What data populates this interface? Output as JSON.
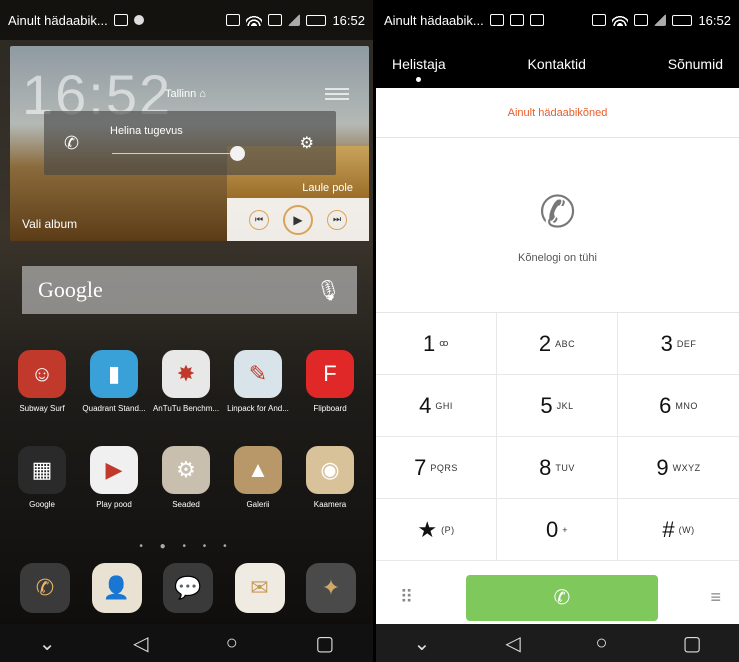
{
  "home": {
    "status": {
      "carrier": "Ainult hädaabik...",
      "time": "16:52"
    },
    "weather": {
      "clock": "16:52",
      "city": "Tallinn"
    },
    "volume": {
      "label": "Helina tugevus",
      "level": 0.85
    },
    "album": {
      "label": "Vali album"
    },
    "music": {
      "title": "Laule pole"
    },
    "search": {
      "label": "Google"
    },
    "apps_row1": [
      {
        "label": "Subway Surf",
        "icon": "subway-surf-icon",
        "color": "#c0392b",
        "glyph": "☺"
      },
      {
        "label": "Quadrant Stand...",
        "icon": "quadrant-icon",
        "color": "#3aa0d8",
        "glyph": "▮"
      },
      {
        "label": "AnTuTu Benchm...",
        "icon": "antutu-icon",
        "color": "#e8e8e8",
        "glyph": "✸"
      },
      {
        "label": "Linpack for And...",
        "icon": "linpack-icon",
        "color": "#d8e4ea",
        "glyph": "✎"
      },
      {
        "label": "Flipboard",
        "icon": "flipboard-icon",
        "color": "#e12828",
        "glyph": "F"
      }
    ],
    "apps_row2": [
      {
        "label": "Google",
        "icon": "google-folder-icon",
        "color": "#2a2a2a",
        "glyph": "▦"
      },
      {
        "label": "Play pood",
        "icon": "play-store-icon",
        "color": "#f0f0f0",
        "glyph": "▶"
      },
      {
        "label": "Seaded",
        "icon": "settings-icon",
        "color": "#c9bfae",
        "glyph": "⚙"
      },
      {
        "label": "Galerii",
        "icon": "gallery-icon",
        "color": "#b89868",
        "glyph": "▲"
      },
      {
        "label": "Kaamera",
        "icon": "camera-icon",
        "color": "#d8c29a",
        "glyph": "◉"
      }
    ],
    "dock": [
      {
        "icon": "phone-icon",
        "color": "#3a3a3a",
        "glyph": "✆",
        "fg": "#e8b468"
      },
      {
        "icon": "contacts-icon",
        "color": "#e9e1d2",
        "glyph": "👤",
        "fg": "#d3a14e"
      },
      {
        "icon": "messages-icon",
        "color": "#3a3a3a",
        "glyph": "💬",
        "fg": "#e0b068"
      },
      {
        "icon": "email-icon",
        "color": "#f0ebe2",
        "glyph": "✉",
        "fg": "#c59a55"
      },
      {
        "icon": "browser-icon",
        "color": "#4a4a4a",
        "glyph": "✦",
        "fg": "#cfa868"
      }
    ]
  },
  "dialer": {
    "status": {
      "carrier": "Ainult hädaabik...",
      "time": "16:52"
    },
    "tabs": [
      "Helistaja",
      "Kontaktid",
      "Sõnumid"
    ],
    "notice": "Ainult hädaabikõned",
    "empty_message": "Kõnelogi on tühi",
    "keys": [
      {
        "digit": "1",
        "sub": "ꝏ"
      },
      {
        "digit": "2",
        "sub": "ABC"
      },
      {
        "digit": "3",
        "sub": "DEF"
      },
      {
        "digit": "4",
        "sub": "GHI"
      },
      {
        "digit": "5",
        "sub": "JKL"
      },
      {
        "digit": "6",
        "sub": "MNO"
      },
      {
        "digit": "7",
        "sub": "PQRS"
      },
      {
        "digit": "8",
        "sub": "TUV"
      },
      {
        "digit": "9",
        "sub": "WXYZ"
      },
      {
        "digit": "★",
        "sub": "(P)"
      },
      {
        "digit": "0",
        "sub": "+"
      },
      {
        "digit": "#",
        "sub": "(W)"
      }
    ]
  }
}
